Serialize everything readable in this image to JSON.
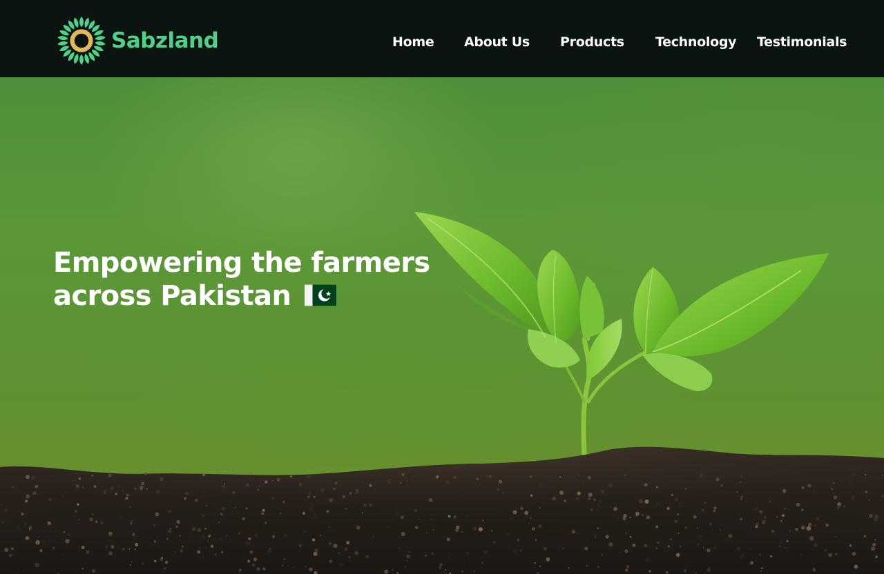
{
  "brand": {
    "name": "Sabzland",
    "logo_icon": "sunflower-logo-icon",
    "colors": {
      "primary_green": "#4fd18b",
      "accent_gold": "#e1b85c"
    }
  },
  "nav": {
    "items": [
      {
        "label": "Home"
      },
      {
        "label": "About Us"
      },
      {
        "label": "Products"
      },
      {
        "label": "Technology"
      },
      {
        "label": "Testimonials"
      }
    ]
  },
  "hero": {
    "headline_line1": "Empowering the farmers",
    "headline_line2": "across Pakistan",
    "flag_icon": "pakistan-flag-icon",
    "background_image": "seedling-in-soil"
  },
  "theme": {
    "navbar_bg": "#0b1411",
    "text": "#ffffff"
  }
}
